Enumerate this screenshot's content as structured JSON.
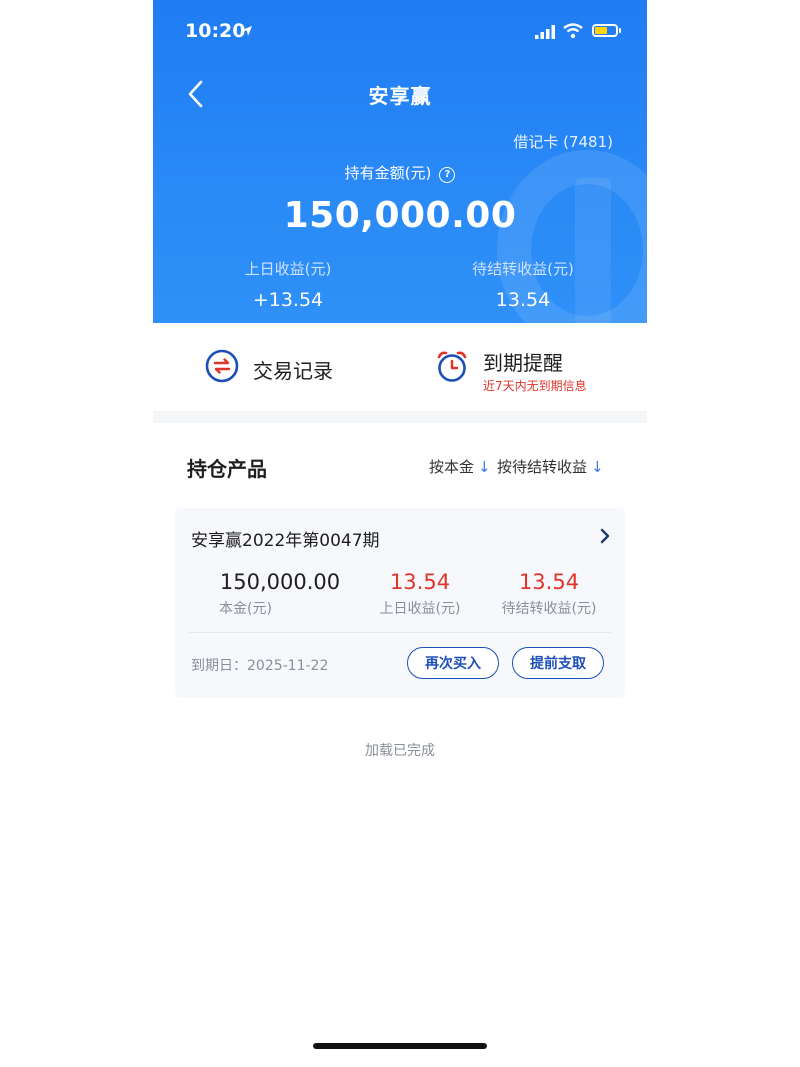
{
  "status_bar": {
    "time": "10:20"
  },
  "header": {
    "title": "安享赢",
    "card": "借记卡 (7481)",
    "holding_label": "持有金额(元)",
    "holding_amount": "150,000.00",
    "yesterday_label": "上日收益(元)",
    "yesterday_value": "+13.54",
    "pending_label": "待结转收益(元)",
    "pending_value": "13.54"
  },
  "quick_actions": {
    "records": "交易记录",
    "reminder": "到期提醒",
    "reminder_sub": "近7天内无到期信息"
  },
  "holdings": {
    "title": "持仓产品",
    "sort_principal": "按本金",
    "sort_pending": "按待结转收益",
    "product": {
      "name": "安享赢2022年第0047期",
      "principal_value": "150,000.00",
      "principal_label": "本金(元)",
      "yesterday_value": "13.54",
      "yesterday_label": "上日收益(元)",
      "pending_value": "13.54",
      "pending_label": "待结转收益(元)",
      "maturity": "到期日：2025-11-22",
      "rebuy_label": "再次买入",
      "early_label": "提前支取"
    }
  },
  "footer": {
    "load_done": "加载已完成"
  },
  "colors": {
    "header_blue": "#2a8af6",
    "accent_red": "#e0332a",
    "button_blue": "#1d4fb8"
  },
  "icons": [
    "location-arrow-icon",
    "signal-icon",
    "wifi-icon",
    "battery-icon",
    "back-icon",
    "help-icon",
    "exchange-icon",
    "alarm-clock-icon",
    "sort-arrow-icon",
    "chevron-right-icon"
  ]
}
